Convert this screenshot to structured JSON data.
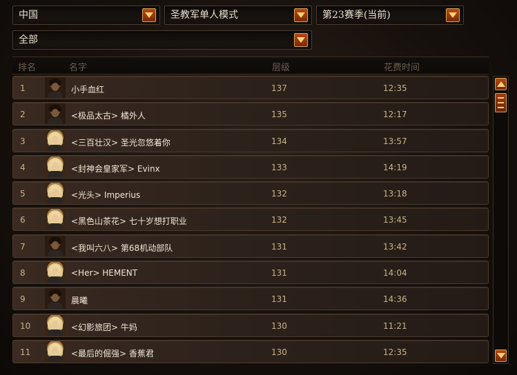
{
  "filters": {
    "region": "中国",
    "mode": "圣教军单人模式",
    "season": "第23赛季(当前)",
    "category": "全部"
  },
  "table": {
    "headers": {
      "rank": "排名",
      "name": "名字",
      "level": "层级",
      "time": "花费时间"
    },
    "rows": [
      {
        "rank": "1",
        "name": "小手血红",
        "level": "137",
        "time": "12:35",
        "portrait": "male-dark"
      },
      {
        "rank": "2",
        "name": "<极品太古> 橘外人",
        "level": "135",
        "time": "12:17",
        "portrait": "male-dark"
      },
      {
        "rank": "3",
        "name": "<三百壮汉> 圣光忽悠着你",
        "level": "134",
        "time": "13:57",
        "portrait": "female-blonde"
      },
      {
        "rank": "4",
        "name": "<封神会皇家军> Evinx",
        "level": "133",
        "time": "14:19",
        "portrait": "female-blonde"
      },
      {
        "rank": "5",
        "name": "<光头> Imperius",
        "level": "132",
        "time": "13:18",
        "portrait": "female-blonde"
      },
      {
        "rank": "6",
        "name": "<黑色山茶花> 七十岁想打职业",
        "level": "132",
        "time": "13:45",
        "portrait": "female-blonde"
      },
      {
        "rank": "7",
        "name": "<我叫六八> 第68机动部队",
        "level": "131",
        "time": "13:42",
        "portrait": "male-dark"
      },
      {
        "rank": "8",
        "name": "<Her> HEMENT",
        "level": "131",
        "time": "14:04",
        "portrait": "female-blonde"
      },
      {
        "rank": "9",
        "name": "晨曦",
        "level": "131",
        "time": "14:36",
        "portrait": "male-dark"
      },
      {
        "rank": "10",
        "name": "<幻影旅团> 牛妈",
        "level": "130",
        "time": "11:21",
        "portrait": "female-blonde"
      },
      {
        "rank": "11",
        "name": "<最后的倔强> 香蕉君",
        "level": "130",
        "time": "12:35",
        "portrait": "female-blonde"
      }
    ]
  },
  "icons": {
    "dropdown": "chevron-down-icon",
    "scroll_up": "chevron-up-icon",
    "scroll_down": "chevron-down-icon"
  },
  "colors": {
    "accent": "#b44a10",
    "text": "#c9b38c",
    "name_text": "#f0e6d6"
  }
}
